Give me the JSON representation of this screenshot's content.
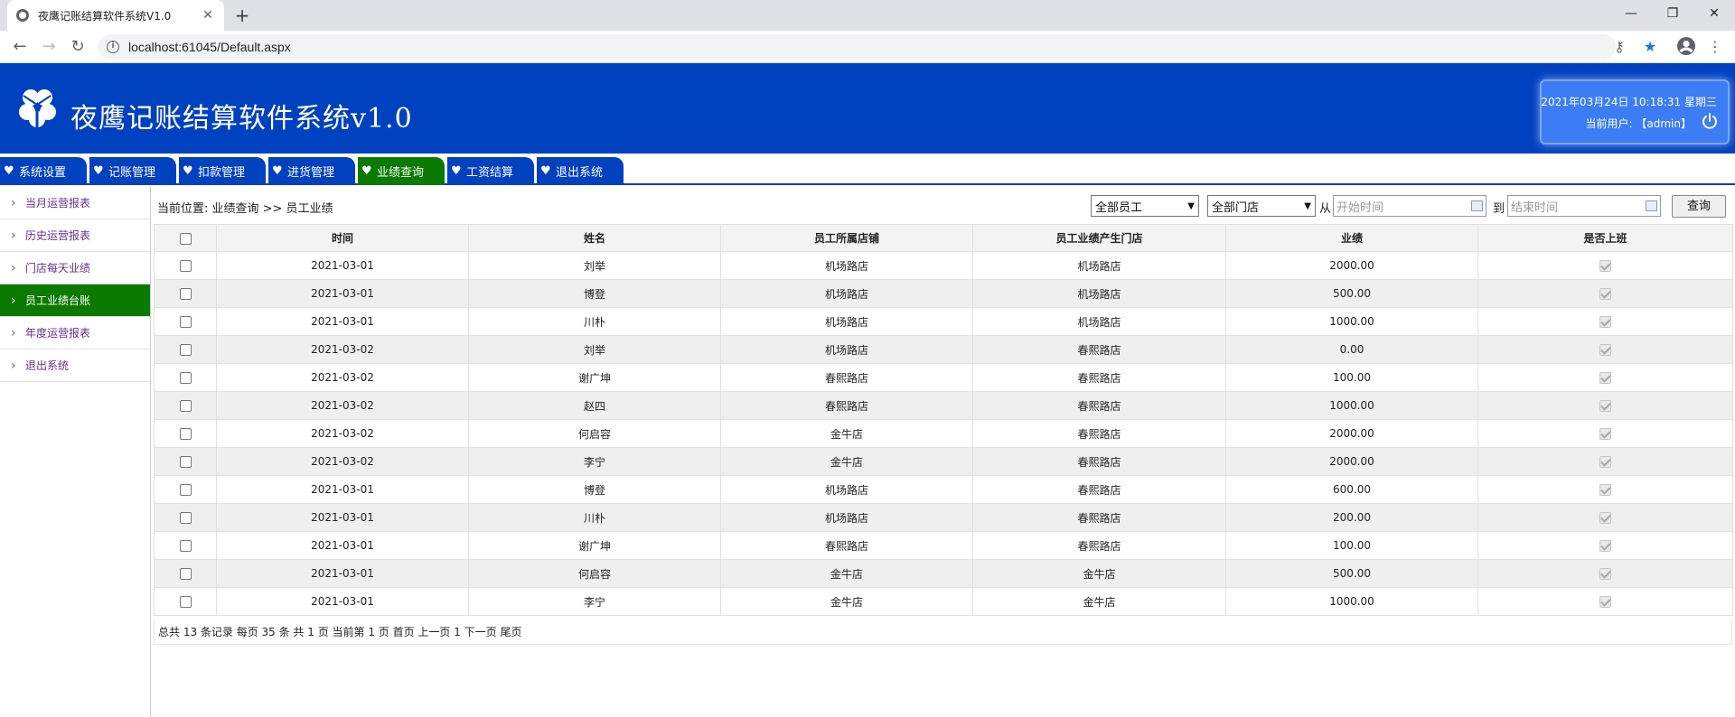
{
  "browser": {
    "tab_title": "夜鹰记账结算软件系统V1.0",
    "url": "localhost:61045/Default.aspx",
    "new_tab": "+",
    "close": "✕",
    "minimize": "—",
    "restore": "❐",
    "win_close": "✕"
  },
  "header": {
    "title": "夜鹰记账结算软件系统v1.0",
    "datetime": "2021年03月24日 10:18:31 星期三",
    "current_user": "当前用户: 【admin】"
  },
  "menu": [
    {
      "label": "系统设置",
      "active": false
    },
    {
      "label": "记账管理",
      "active": false
    },
    {
      "label": "扣款管理",
      "active": false
    },
    {
      "label": "进货管理",
      "active": false
    },
    {
      "label": "业绩查询",
      "active": true
    },
    {
      "label": "工资结算",
      "active": false
    },
    {
      "label": "退出系统",
      "active": false
    }
  ],
  "sidebar": [
    {
      "label": "当月运营报表",
      "active": false
    },
    {
      "label": "历史运营报表",
      "active": false
    },
    {
      "label": "门店每天业绩",
      "active": false
    },
    {
      "label": "员工业绩台账",
      "active": true
    },
    {
      "label": "年度运营报表",
      "active": false
    },
    {
      "label": "退出系统",
      "active": false
    }
  ],
  "toolbar": {
    "breadcrumb": "当前位置: 业绩查询 >> 员工业绩",
    "employee_select": "全部员工",
    "store_select": "全部门店",
    "from_label": "从",
    "start_placeholder": "开始时间",
    "to_label": "到",
    "end_placeholder": "结束时间",
    "query_button": "查询"
  },
  "table": {
    "columns": [
      "时间",
      "姓名",
      "员工所属店铺",
      "员工业绩产生门店",
      "业绩",
      "是否上班"
    ],
    "rows": [
      [
        "2021-03-01",
        "刘举",
        "机场路店",
        "机场路店",
        "2000.00"
      ],
      [
        "2021-03-01",
        "博登",
        "机场路店",
        "机场路店",
        "500.00"
      ],
      [
        "2021-03-01",
        "川朴",
        "机场路店",
        "机场路店",
        "1000.00"
      ],
      [
        "2021-03-02",
        "刘举",
        "机场路店",
        "春熙路店",
        "0.00"
      ],
      [
        "2021-03-02",
        "谢广坤",
        "春熙路店",
        "春熙路店",
        "100.00"
      ],
      [
        "2021-03-02",
        "赵四",
        "春熙路店",
        "春熙路店",
        "1000.00"
      ],
      [
        "2021-03-02",
        "何启容",
        "金牛店",
        "春熙路店",
        "2000.00"
      ],
      [
        "2021-03-02",
        "李宁",
        "金牛店",
        "春熙路店",
        "2000.00"
      ],
      [
        "2021-03-01",
        "博登",
        "机场路店",
        "春熙路店",
        "600.00"
      ],
      [
        "2021-03-01",
        "川朴",
        "机场路店",
        "春熙路店",
        "200.00"
      ],
      [
        "2021-03-01",
        "谢广坤",
        "春熙路店",
        "春熙路店",
        "100.00"
      ],
      [
        "2021-03-01",
        "何启容",
        "金牛店",
        "金牛店",
        "500.00"
      ],
      [
        "2021-03-01",
        "李宁",
        "金牛店",
        "金牛店",
        "1000.00"
      ]
    ]
  },
  "pager": {
    "text": "总共 13 条记录 每页 35 条 共 1 页 当前第 1 页 首页 上一页  1  下一页 尾页"
  }
}
